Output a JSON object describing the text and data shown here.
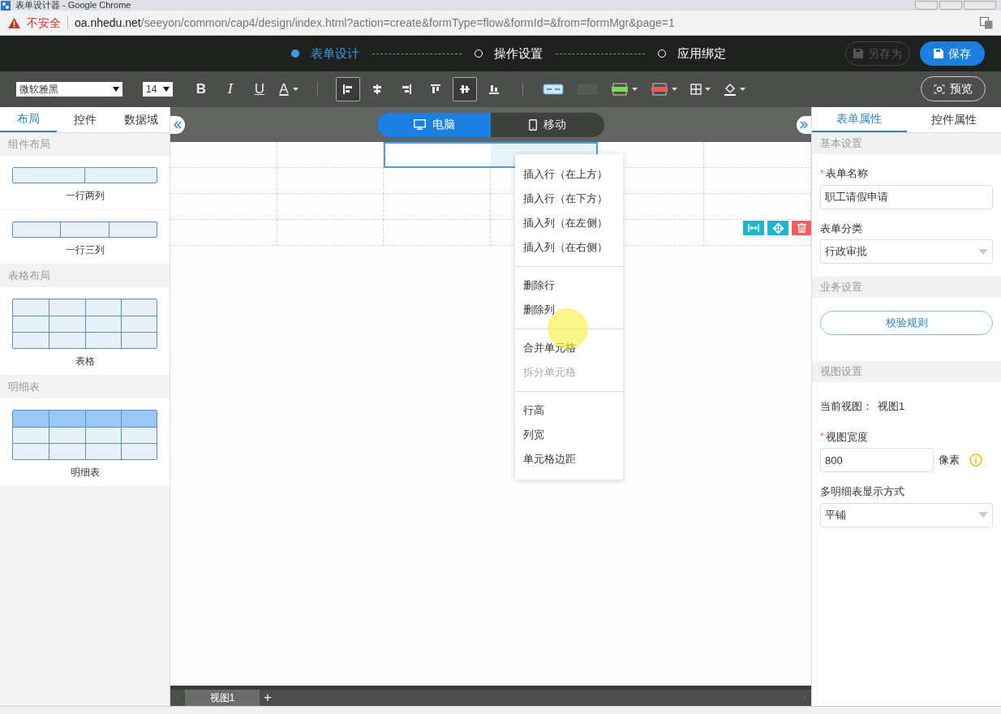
{
  "browser": {
    "title": "表单设计器 - Google Chrome",
    "security": "不安全",
    "url_host": "oa.nhedu.net",
    "url_path": "/seeyon/common/cap4/design/index.html?action=create&formType=flow&formId=&from=formMgr&page=1"
  },
  "steps": [
    {
      "label": "表单设计",
      "selected": true
    },
    {
      "label": "操作设置",
      "selected": false
    },
    {
      "label": "应用绑定",
      "selected": false
    }
  ],
  "header_buttons": [
    {
      "label": "另存为",
      "disabled": true
    },
    {
      "label": "保存",
      "disabled": false
    }
  ],
  "toolbar": {
    "font": "微软雅黑",
    "size": "14",
    "format_buttons": [
      {
        "label": "B",
        "kind": "bold"
      },
      {
        "label": "I",
        "kind": "italic"
      },
      {
        "label": "U",
        "kind": "underline"
      },
      {
        "label": "A",
        "kind": "color"
      }
    ],
    "align_buttons": [
      {
        "kind": "left",
        "selected": true
      },
      {
        "kind": "center",
        "selected": false
      },
      {
        "kind": "right",
        "selected": false
      },
      {
        "kind": "top",
        "selected": false
      },
      {
        "kind": "middle",
        "selected": true
      },
      {
        "kind": "bottom",
        "selected": false
      }
    ],
    "table_tools": [
      {
        "kind": "merge",
        "disabled": false,
        "dropdown": false
      },
      {
        "kind": "split",
        "disabled": true,
        "dropdown": false
      },
      {
        "kind": "insert",
        "disabled": false,
        "dropdown": true
      },
      {
        "kind": "delete",
        "disabled": false,
        "dropdown": true
      },
      {
        "kind": "border",
        "disabled": false,
        "dropdown": true
      },
      {
        "kind": "fill",
        "disabled": false,
        "dropdown": true
      }
    ],
    "preview": "预览"
  },
  "left_panel": {
    "tabs": [
      {
        "label": "布局",
        "selected": true
      },
      {
        "label": "控件",
        "selected": false
      },
      {
        "label": "数据域",
        "selected": false
      }
    ],
    "sections": [
      {
        "title": "组件布局",
        "items": [
          {
            "label": "一行两列",
            "kind": "two"
          },
          {
            "label": "一行三列",
            "kind": "three"
          }
        ]
      },
      {
        "title": "表格布局",
        "items": [
          {
            "label": "表格",
            "kind": "table"
          }
        ]
      },
      {
        "title": "明细表",
        "items": [
          {
            "label": "明细表",
            "kind": "detail"
          }
        ]
      }
    ]
  },
  "canvas": {
    "device_tabs": [
      {
        "label": "电脑",
        "kind": "desktop",
        "selected": true
      },
      {
        "label": "移动",
        "kind": "mobile",
        "selected": false
      }
    ],
    "grid": [
      {
        "cells": [
          {
            "selected": false
          },
          {
            "selected": false
          },
          {
            "selected": true
          },
          {
            "selected": true
          },
          {
            "selected": false
          },
          {
            "selected": false
          }
        ]
      },
      {
        "cells": [
          {
            "selected": false
          },
          {
            "selected": false
          },
          {
            "selected": false
          },
          {
            "selected": false
          },
          {
            "selected": false
          },
          {
            "selected": false
          }
        ]
      },
      {
        "cells": [
          {
            "selected": false
          },
          {
            "selected": false
          },
          {
            "selected": false
          },
          {
            "selected": false
          },
          {
            "selected": false
          },
          {
            "selected": false
          }
        ]
      },
      {
        "cells": [
          {
            "selected": false
          },
          {
            "selected": false
          },
          {
            "selected": false
          },
          {
            "selected": false
          },
          {
            "selected": false
          },
          {
            "selected": false
          }
        ]
      }
    ],
    "row_tools": [
      {
        "kind": "resize"
      },
      {
        "kind": "move"
      },
      {
        "kind": "delete"
      }
    ],
    "context_menu": [
      [
        {
          "label": "插入行（在上方）",
          "disabled": false
        },
        {
          "label": "插入行（在下方）",
          "disabled": false
        },
        {
          "label": "插入列（在左侧）",
          "disabled": false
        },
        {
          "label": "插入列（在右侧）",
          "disabled": false
        }
      ],
      [
        {
          "label": "删除行",
          "disabled": false
        },
        {
          "label": "删除列",
          "disabled": false
        }
      ],
      [
        {
          "label": "合并单元格",
          "disabled": false
        },
        {
          "label": "拆分单元格",
          "disabled": true
        }
      ],
      [
        {
          "label": "行高",
          "disabled": false
        },
        {
          "label": "列宽",
          "disabled": false
        },
        {
          "label": "单元格边距",
          "disabled": false
        }
      ]
    ],
    "view_tabs": [
      {
        "label": "视图1",
        "selected": true
      }
    ],
    "add_view": "+"
  },
  "right_panel": {
    "tabs": [
      {
        "label": "表单属性",
        "selected": true
      },
      {
        "label": "控件属性",
        "selected": false
      }
    ],
    "sections": [
      {
        "title": "基本设置",
        "fields": [
          {
            "kind": "text",
            "label": "表单名称",
            "required_mark": "*",
            "value": "职工请假申请"
          },
          {
            "kind": "select",
            "label": "表单分类",
            "value": "行政审批"
          }
        ]
      },
      {
        "title": "业务设置",
        "fields": [
          {
            "kind": "button",
            "label": "校验规则"
          }
        ]
      },
      {
        "title": "视图设置",
        "fields": [
          {
            "kind": "info",
            "label": "当前视图：",
            "value": "视图1"
          },
          {
            "kind": "text",
            "label": "视图宽度",
            "required_mark": "*",
            "value": "800",
            "unit": "像素"
          },
          {
            "kind": "select",
            "label": "多明细表显示方式",
            "value": "平铺"
          }
        ]
      }
    ]
  }
}
